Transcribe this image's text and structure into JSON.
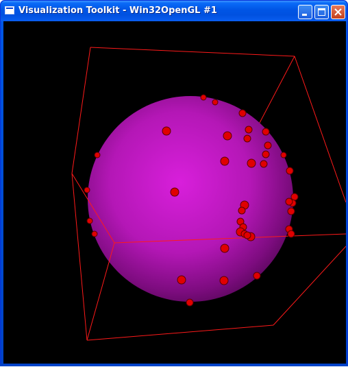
{
  "window": {
    "title": "Visualization Toolkit - Win32OpenGL #1",
    "app_icon": "vtk-window-icon",
    "controls": [
      "minimize-icon",
      "maximize-icon",
      "close-icon"
    ]
  },
  "render": {
    "background_color": "#000000",
    "sphere_color": "#c21ac4",
    "outline_color": "#ff1a1a",
    "glyph_color": "#e00000"
  }
}
